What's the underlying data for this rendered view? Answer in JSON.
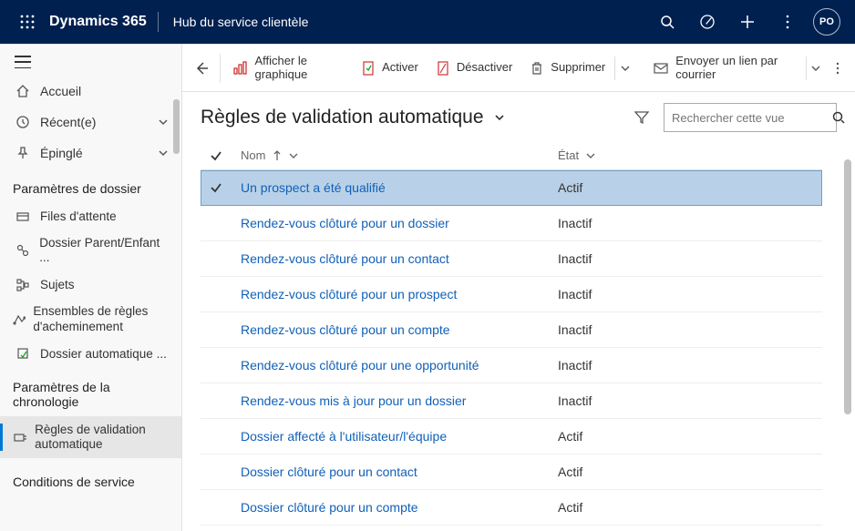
{
  "topbar": {
    "brand": "Dynamics 365",
    "hub": "Hub du service clientèle",
    "avatar": "PO"
  },
  "sidebar": {
    "home": "Accueil",
    "recent": "Récent(e)",
    "pinned": "Épinglé",
    "group1_title": "Paramètres de dossier",
    "group1_items": [
      "Files d'attente",
      "Dossier Parent/Enfant ...",
      "Sujets",
      "Ensembles de règles d'acheminement",
      "Dossier automatique ..."
    ],
    "group2_title": "Paramètres de la chronologie",
    "group2_items": [
      "Règles de validation automatique"
    ],
    "group3_title": "Conditions de service"
  },
  "commands": {
    "chart": "Afficher le graphique",
    "activate": "Activer",
    "deactivate": "Désactiver",
    "delete": "Supprimer",
    "emaillink": "Envoyer un lien par courrier"
  },
  "view": {
    "title": "Règles de validation automatique",
    "search_placeholder": "Rechercher cette vue"
  },
  "columns": {
    "name": "Nom",
    "state": "État"
  },
  "rows": [
    {
      "name": "Un prospect a été qualifié",
      "state": "Actif",
      "selected": true
    },
    {
      "name": "Rendez-vous clôturé pour un dossier",
      "state": "Inactif"
    },
    {
      "name": "Rendez-vous clôturé pour un contact",
      "state": "Inactif"
    },
    {
      "name": "Rendez-vous clôturé pour un prospect",
      "state": "Inactif"
    },
    {
      "name": "Rendez-vous clôturé pour un compte",
      "state": "Inactif"
    },
    {
      "name": "Rendez-vous clôturé pour une opportunité",
      "state": "Inactif"
    },
    {
      "name": "Rendez-vous mis à jour pour un dossier",
      "state": "Inactif"
    },
    {
      "name": "Dossier affecté à l'utilisateur/l'équipe",
      "state": "Actif"
    },
    {
      "name": "Dossier clôturé pour un contact",
      "state": "Actif"
    },
    {
      "name": "Dossier clôturé pour un compte",
      "state": "Actif"
    }
  ]
}
